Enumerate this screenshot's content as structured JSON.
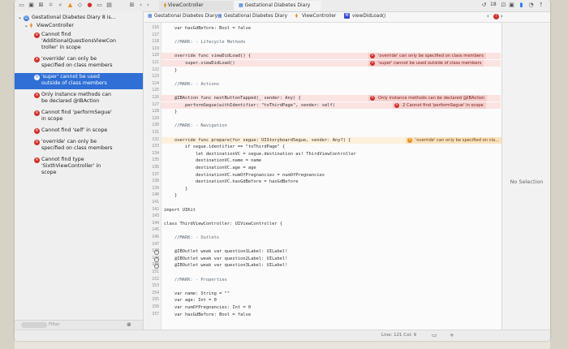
{
  "toolbar": {
    "scheme_target": "ViewController",
    "tabs": [
      "ViewController",
      "Gestational Diabetes Diary"
    ],
    "badge": "18"
  },
  "navigator": {
    "root": "Gestational Diabetes Diary 8 is...",
    "file": "ViewController",
    "issues": [
      {
        "kind": "error",
        "lines": [
          "Cannot find",
          "'AdditionalQuestionsViewCon",
          "troller' in scope"
        ]
      },
      {
        "kind": "error",
        "lines": [
          "'override' can only be",
          "specified on class members"
        ]
      },
      {
        "kind": "error",
        "selected": true,
        "lines": [
          "'super' cannot be used",
          "outside of class members"
        ]
      },
      {
        "kind": "error",
        "lines": [
          "Only instance methods can",
          "be declared @IBAction"
        ]
      },
      {
        "kind": "error",
        "lines": [
          "Cannot find 'performSegue'",
          "in scope"
        ]
      },
      {
        "kind": "error",
        "lines": [
          "Cannot find 'self' in scope"
        ]
      },
      {
        "kind": "error",
        "lines": [
          "'override' can only be",
          "specified on class members"
        ]
      },
      {
        "kind": "error",
        "lines": [
          "Cannot find type",
          "'SixthViewController' in",
          "scope"
        ]
      }
    ],
    "filter_placeholder": "Filter"
  },
  "jumpbar": {
    "crumbs": [
      "Gestational Diabetes Diary",
      "Gestational Diabetes Diary",
      "ViewController",
      "viewDidLoad()"
    ]
  },
  "editor": {
    "lines": [
      {
        "n": "116",
        "t": "    var hasGdBefore: Bool = false"
      },
      {
        "n": "117",
        "t": ""
      },
      {
        "n": "118",
        "t": "    //MARK: - Lifecycle Methods"
      },
      {
        "n": "119",
        "t": ""
      },
      {
        "n": "120",
        "t": "    override func viewDidLoad() {"
      },
      {
        "n": "121",
        "t": "        super.viewDidLoad()"
      },
      {
        "n": "122",
        "t": "    }"
      },
      {
        "n": "123",
        "t": ""
      },
      {
        "n": "124",
        "t": "    //MARK: - Actions"
      },
      {
        "n": "125",
        "t": ""
      },
      {
        "n": "126",
        "t": "    @IBAction func nextButtonTapped(_ sender: Any) {"
      },
      {
        "n": "127",
        "t": "        performSegue(withIdentifier: \"toThirdPage\", sender: self)"
      },
      {
        "n": "128",
        "t": "    }"
      },
      {
        "n": "129",
        "t": ""
      },
      {
        "n": "130",
        "t": "    //MARK: - Navigation"
      },
      {
        "n": "131",
        "t": ""
      },
      {
        "n": "132",
        "t": "    override func prepare(for segue: UIStoryboardSegue, sender: Any?) {"
      },
      {
        "n": "133",
        "t": "        if segue.identifier == \"toThirdPage\" {"
      },
      {
        "n": "134",
        "t": "            let destinationVC = segue.destination as! ThirdViewController"
      },
      {
        "n": "135",
        "t": "            destinationVC.name = name"
      },
      {
        "n": "136",
        "t": "            destinationVC.age = age"
      },
      {
        "n": "137",
        "t": "            destinationVC.numOfPregnancies = numOfPregnancies"
      },
      {
        "n": "138",
        "t": "            destinationVC.hasGdBefore = hasGdBefore"
      },
      {
        "n": "139",
        "t": "        }"
      },
      {
        "n": "140",
        "t": "    }"
      },
      {
        "n": "141",
        "t": ""
      },
      {
        "n": "142",
        "t": "import UIKit"
      },
      {
        "n": "143",
        "t": ""
      },
      {
        "n": "144",
        "t": "class ThirdViewController: UIViewController {"
      },
      {
        "n": "145",
        "t": ""
      },
      {
        "n": "146",
        "t": "    //MARK: - Outlets"
      },
      {
        "n": "147",
        "t": ""
      },
      {
        "n": "148",
        "t": "    @IBOutlet weak var question1Label: UILabel!"
      },
      {
        "n": "149",
        "t": "    @IBOutlet weak var question2Label: UILabel!"
      },
      {
        "n": "150",
        "t": "    @IBOutlet weak var question3Label: UILabel!"
      },
      {
        "n": "151",
        "t": ""
      },
      {
        "n": "152",
        "t": "    //MARK: - Properties"
      },
      {
        "n": "153",
        "t": ""
      },
      {
        "n": "154",
        "t": "    var name: String = \"\""
      },
      {
        "n": "155",
        "t": "    var age: Int = 0"
      },
      {
        "n": "156",
        "t": "    var numOfPregnancies: Int = 0"
      },
      {
        "n": "157",
        "t": "    var hasGdBefore: Bool = false"
      }
    ],
    "annotations": {
      "a1": "'override' can only be specified on class members",
      "a2": "'super' cannot be used outside of class members",
      "a3": "Only instance methods can be declared @IBAction",
      "a4": "Cannot find 'performSegue' in scope",
      "a4_count": "2",
      "a5": "'override' can only be specified on cla..."
    }
  },
  "inspector": {
    "empty_text": "No Selection"
  },
  "status": {
    "position": "Line: 121  Col: 9"
  },
  "colors": {
    "error": "#d0302a",
    "warning": "#e88c1e",
    "selection": "#2f6fd6"
  }
}
